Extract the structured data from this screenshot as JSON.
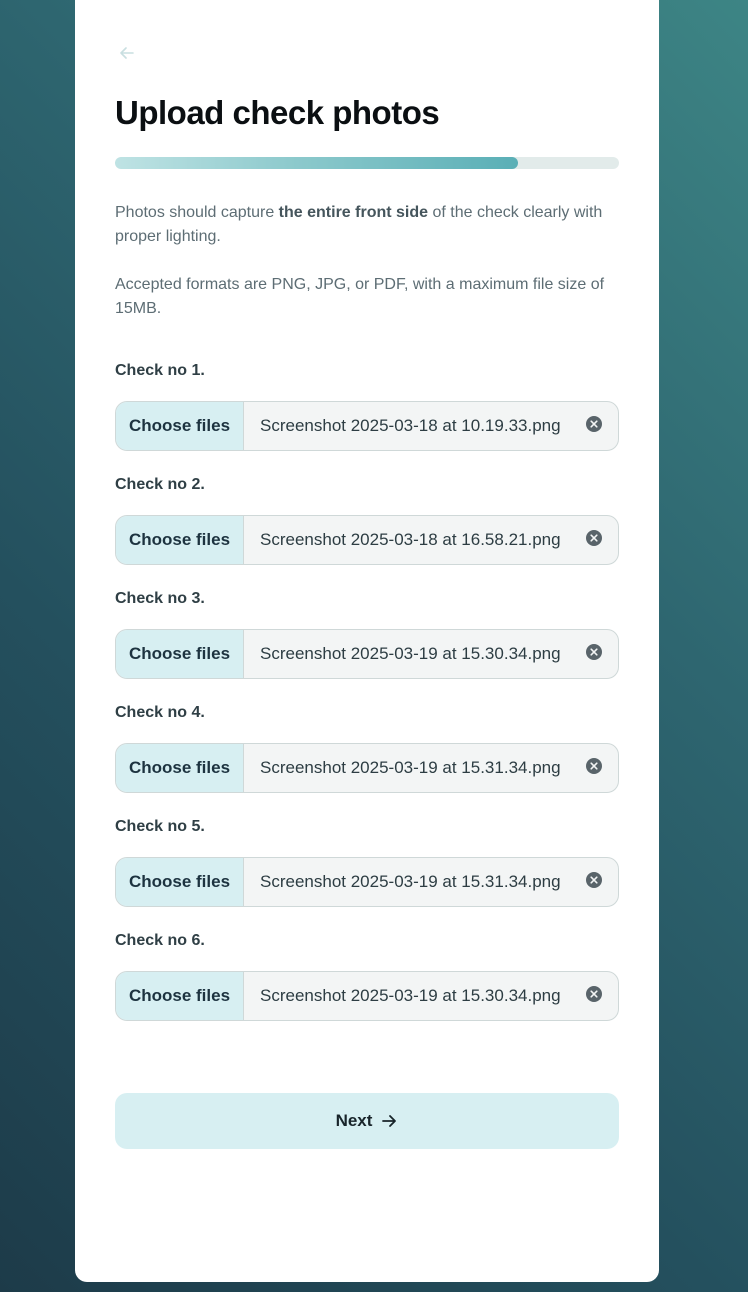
{
  "page": {
    "title": "Upload check photos",
    "progress": 0.8,
    "description_parts": {
      "before": "Photos should capture ",
      "bold": "the entire front side",
      "after": " of the check clearly with proper lighting."
    },
    "formats_text": "Accepted formats are PNG, JPG, or PDF, with a maximum file size of 15MB."
  },
  "checks": [
    {
      "label": "Check no 1.",
      "button_label": "Choose files",
      "file_name": "Screenshot 2025-03-18 at 10.19.33.png"
    },
    {
      "label": "Check no 2.",
      "button_label": "Choose files",
      "file_name": "Screenshot 2025-03-18 at 16.58.21.png"
    },
    {
      "label": "Check no 3.",
      "button_label": "Choose files",
      "file_name": "Screenshot 2025-03-19 at 15.30.34.png"
    },
    {
      "label": "Check no 4.",
      "button_label": "Choose files",
      "file_name": "Screenshot 2025-03-19 at 15.31.34.png"
    },
    {
      "label": "Check no 5.",
      "button_label": "Choose files",
      "file_name": "Screenshot 2025-03-19 at 15.31.34.png"
    },
    {
      "label": "Check no 6.",
      "button_label": "Choose files",
      "file_name": "Screenshot 2025-03-19 at 15.30.34.png"
    }
  ],
  "actions": {
    "next_label": "Next"
  },
  "icons": {
    "back": "arrow-left-icon",
    "remove": "close-circle-icon",
    "next": "arrow-right-icon"
  },
  "colors": {
    "accent_light": "#d7eff2",
    "progress_fill_end": "#5aafb6",
    "text_dark": "#0b0f12"
  }
}
